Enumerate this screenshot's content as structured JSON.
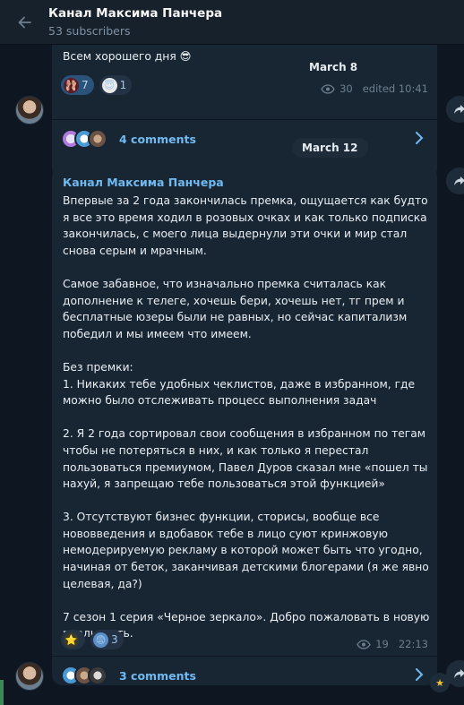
{
  "header": {
    "title": "Канал Максима Панчера",
    "subscribers": "53 subscribers"
  },
  "date_floating": "March 8",
  "date_separator": "March 12",
  "post1": {
    "text_tail": "Всем хорошего дня",
    "text_emoji": "😎",
    "reactions": [
      {
        "emoji": "🩰",
        "count": "7"
      },
      {
        "emoji": "😇",
        "count": "1"
      }
    ],
    "views": "30",
    "edited_time": "edited 10:41",
    "comments": "4 comments"
  },
  "post2": {
    "author": "Канал Максима Панчера",
    "text": "Впервые за 2 года закончилась премка, ощущается как будто я все это время ходил в розовых очках и как только подписка закончилась, с моего лица выдернули эти очки и мир стал снова серым и мрачным.\n\nСамое забавное, что изначально премка считалась как дополнение к телеге, хочешь бери, хочешь нет, тг прем и бесплатные юзеры были не равных, но сейчас капитализм победил и мы имеем что имеем.\n\nБез премки:\n1. Никаких тебе удобных чеклистов, даже в избранном, где можно было отслеживать процесс выполнения задач\n\n2. Я 2 года сортировал свои сообщения в избранном по тегам чтобы не потеряться в них, и как только я перестал пользоваться премиумом, Павел Дуров сказал мне «пошел ты нахуй, я запрещаю тебе пользоваться этой функцией»\n\n3. Отсутствуют бизнес функции, сторисы, вообще все нововведения и вдобавок тебе в лицо суют кринжовую немодерируемую рекламу в которой может быть что угодно, начиная от беток, заканчивая детскими блогерами (я же явно целевая, да?)\n\n7 сезон 1 серия «Черное зеркало». Добро пожаловать в новую реальность.",
    "reactions": [
      {
        "emoji": "⭐",
        "count": ""
      },
      {
        "emoji": "😨",
        "count": "3"
      }
    ],
    "views": "19",
    "time": "22:13",
    "comments": "3 comments"
  },
  "colors": {
    "background": "#0e1621",
    "bubble": "#182533",
    "accent": "#71baf1",
    "reaction_bg": "#2b5278"
  }
}
